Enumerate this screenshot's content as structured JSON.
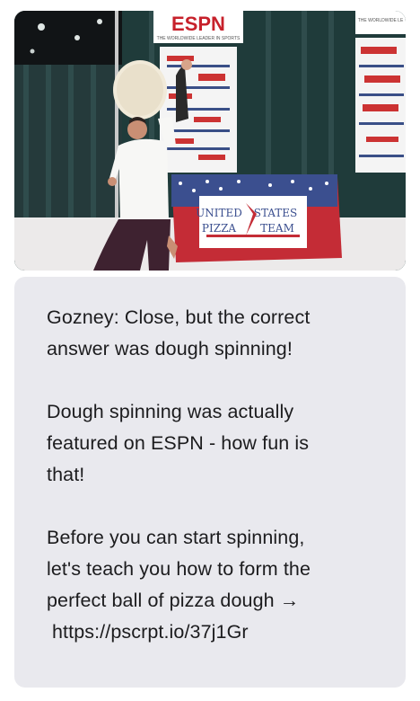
{
  "photo": {
    "description_icon": "photo-image",
    "banner_left": "ESPN",
    "banner_left_tagline": "THE WORLDWIDE LEADER IN SPORTS",
    "banner_right_tagline": "THE WORLDWIDE LE",
    "table_sign_line1_left": "UNITED",
    "table_sign_line1_right": "STATES",
    "table_sign_line2_left": "PIZZA",
    "table_sign_line2_right": "TEAM"
  },
  "message": {
    "para1": [
      "Gozney: Close, but the correct",
      "answer was dough spinning!"
    ],
    "para2": [
      "Dough spinning was actually",
      "featured on ESPN - how fun is",
      "that!"
    ],
    "para3": [
      "Before you can start spinning,",
      "let's teach you how to form the",
      "perfect ball of pizza dough →"
    ],
    "link": "https://pscrpt.io/37j1Gr"
  },
  "colors": {
    "bubble_bg": "#e9e9ee",
    "text": "#1c1c1e"
  }
}
